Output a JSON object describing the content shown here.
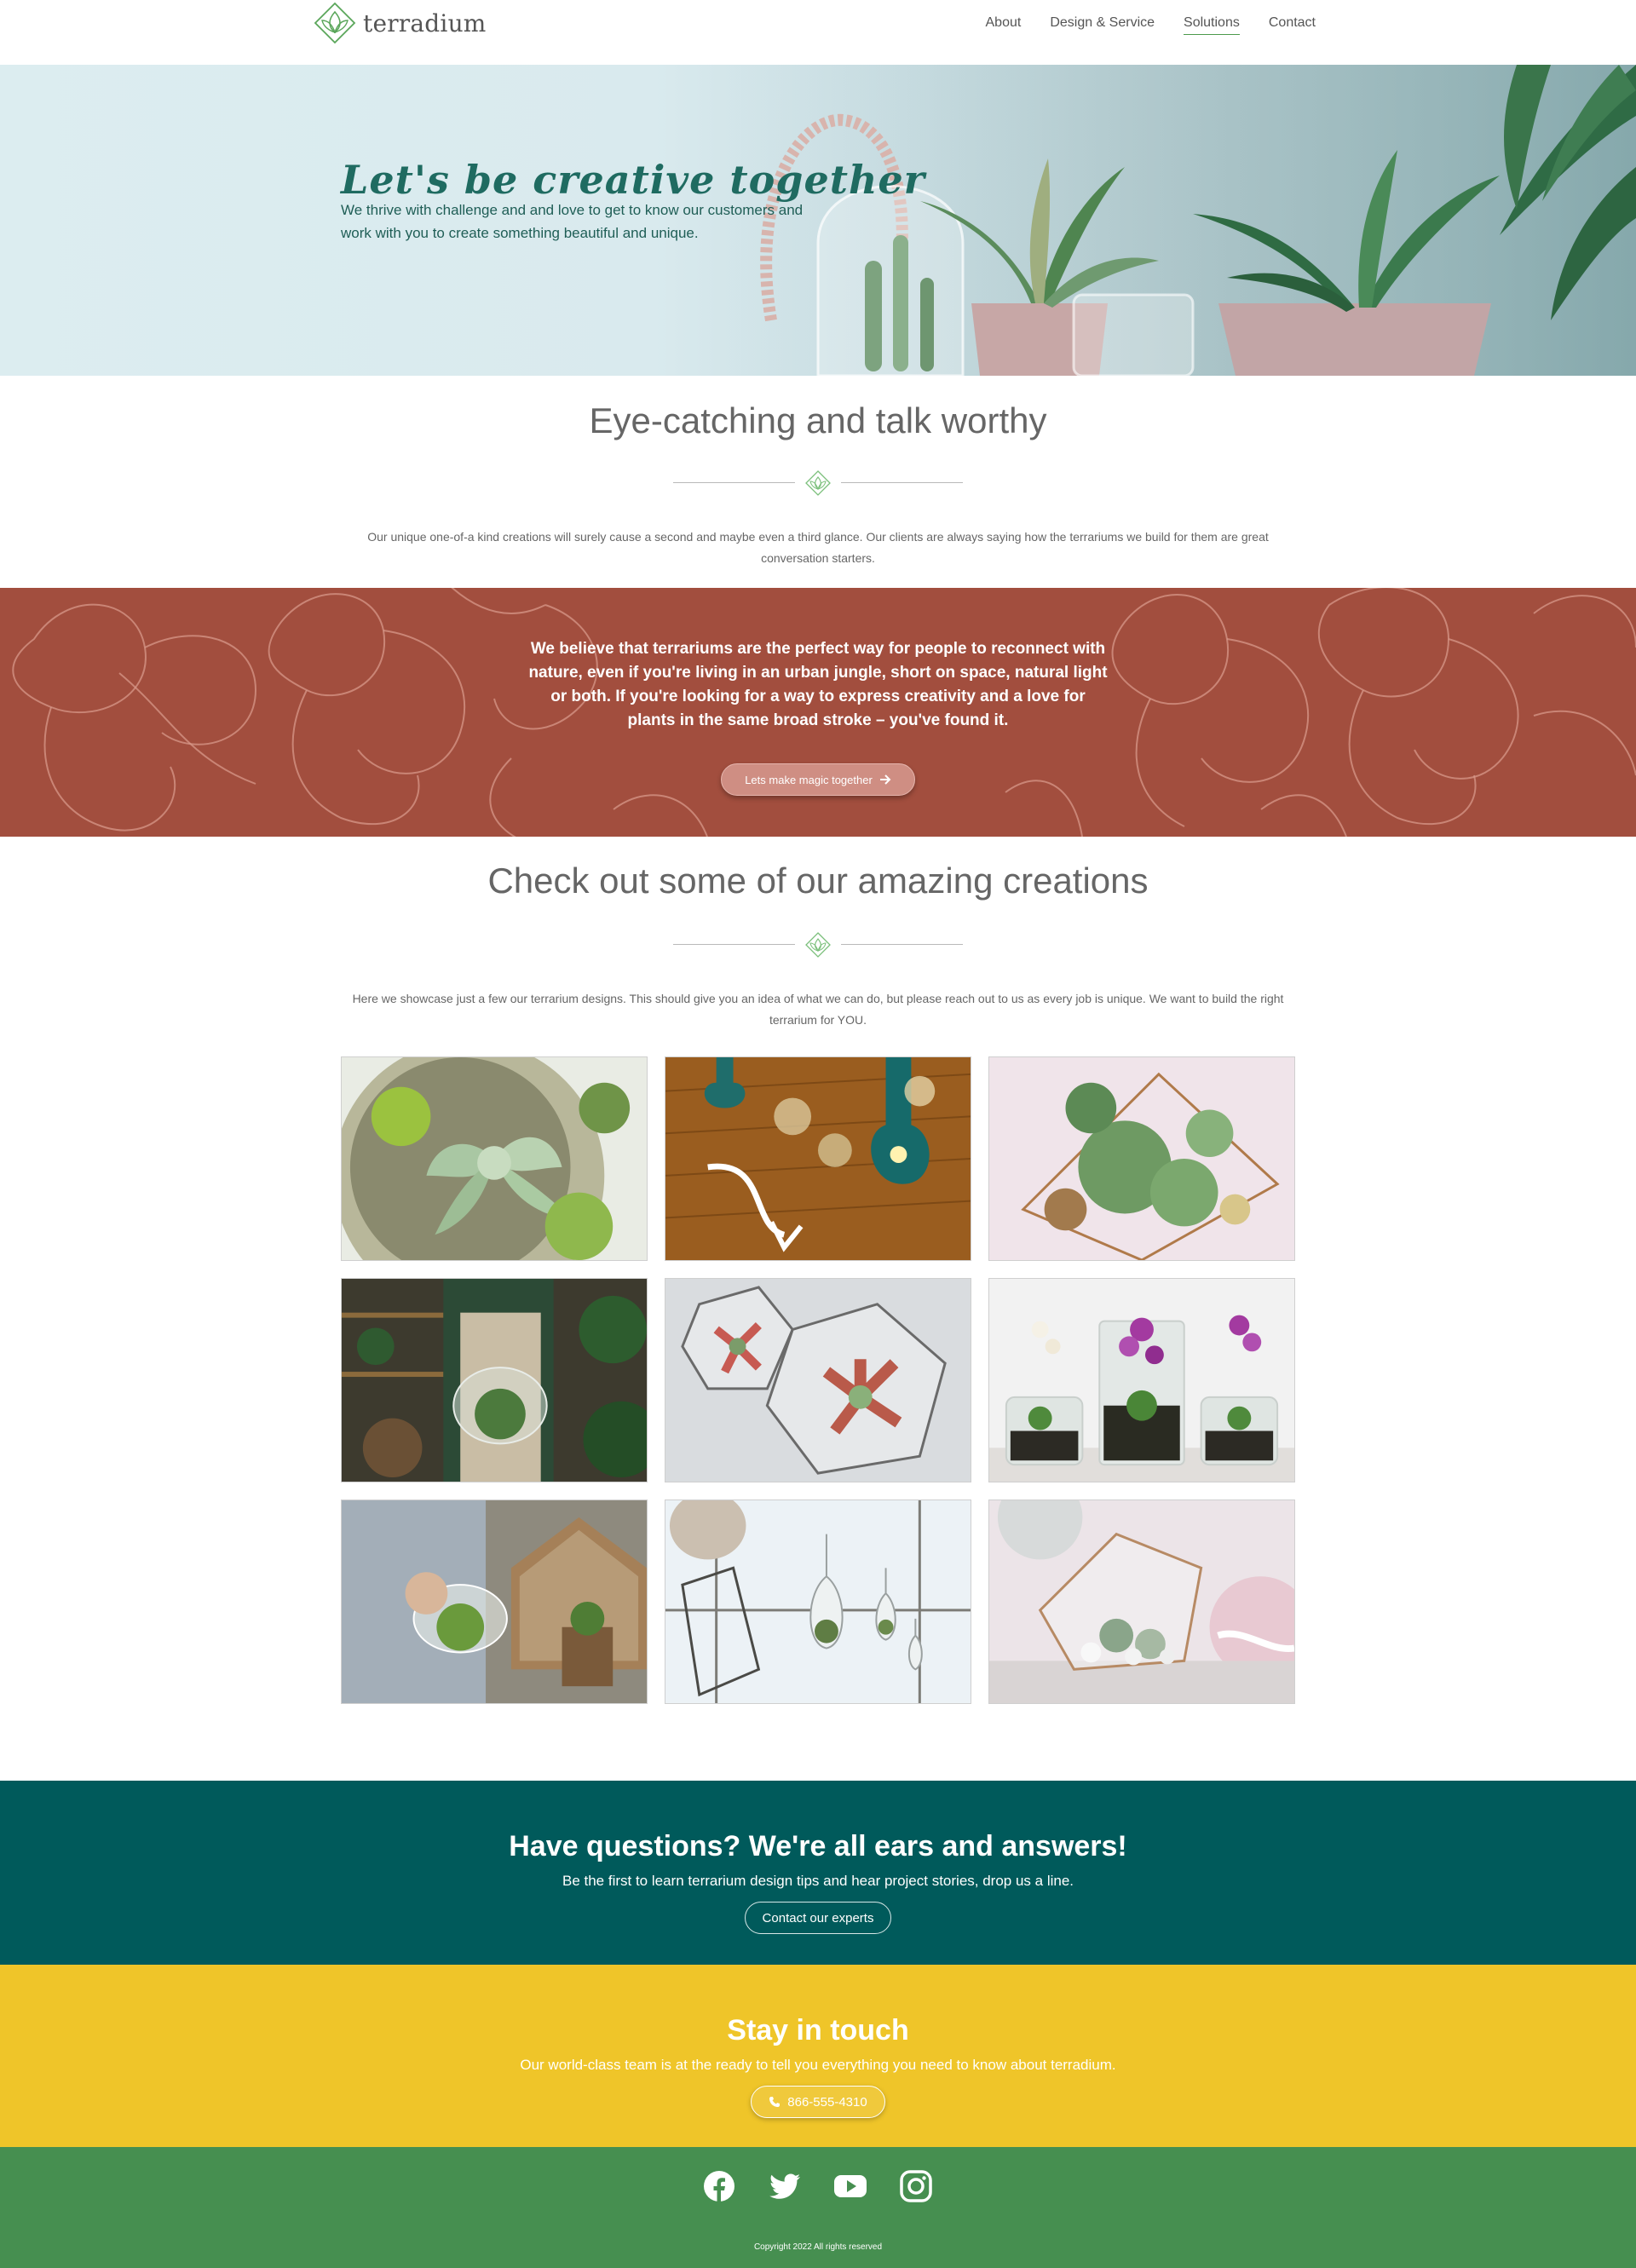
{
  "brand": {
    "name": "terradium",
    "accent": "#4c9a4c"
  },
  "nav": {
    "items": [
      {
        "label": "About"
      },
      {
        "label": "Design & Service"
      },
      {
        "label": "Solutions",
        "active": true
      },
      {
        "label": "Contact"
      }
    ]
  },
  "hero": {
    "title": "Let's be creative together",
    "subtitle": "We thrive with challenge and and love to get to know our customers and work with you to create something beautiful and unique."
  },
  "section1": {
    "title": "Eye-catching and talk worthy",
    "body": "Our unique one-of-a kind creations will surely cause a second and maybe even a third glance.  Our clients are always saying how the terrariums we build for them are great conversation starters."
  },
  "mission": {
    "text": "We believe that terrariums are the perfect way for people to reconnect with nature, even if you're living in an urban jungle, short on space, natural light or both.  If you're looking for a way to express creativity and a love for plants in the same broad stroke – you've found it.",
    "button_label": "Lets make magic together",
    "button_icon": "arrow-right-icon",
    "color": "#a24e3e"
  },
  "section2": {
    "title": "Check out some of our amazing creations",
    "body": "Here we showcase just a few  our terrarium designs.  This should give you an idea of what we can do, but please reach out to us as every job is unique.  We want to build the right terrarium for YOU."
  },
  "gallery": {
    "images": [
      {
        "subject": "succulents-closeup"
      },
      {
        "subject": "hanging-glass-terrariums"
      },
      {
        "subject": "geometric-glass-succulents"
      },
      {
        "subject": "gardener-holding-terrarium"
      },
      {
        "subject": "geometric-terrariums-grey"
      },
      {
        "subject": "orchid-glass-vases"
      },
      {
        "subject": "man-assembling-terrarium"
      },
      {
        "subject": "hanging-teardrop-terrariums"
      },
      {
        "subject": "geometric-terrarium-pink"
      }
    ]
  },
  "contact_band": {
    "title": "Have questions? We're all ears and answers!",
    "subtitle": "Be the first to learn terrarium design tips and hear project stories, drop us a line.",
    "button_label": "Contact our experts",
    "color": "#005a5b"
  },
  "touch_band": {
    "title": "Stay in touch",
    "subtitle": "Our world-class team is at the ready to tell you everything you need to know about terradium.",
    "phone": "866-555-4310",
    "phone_icon": "phone-icon",
    "color": "#efc529"
  },
  "footer": {
    "socials": [
      "facebook-icon",
      "twitter-icon",
      "youtube-icon",
      "instagram-icon"
    ],
    "copyright": "Copyright 2022 All rights reserved",
    "color": "#468f50"
  }
}
